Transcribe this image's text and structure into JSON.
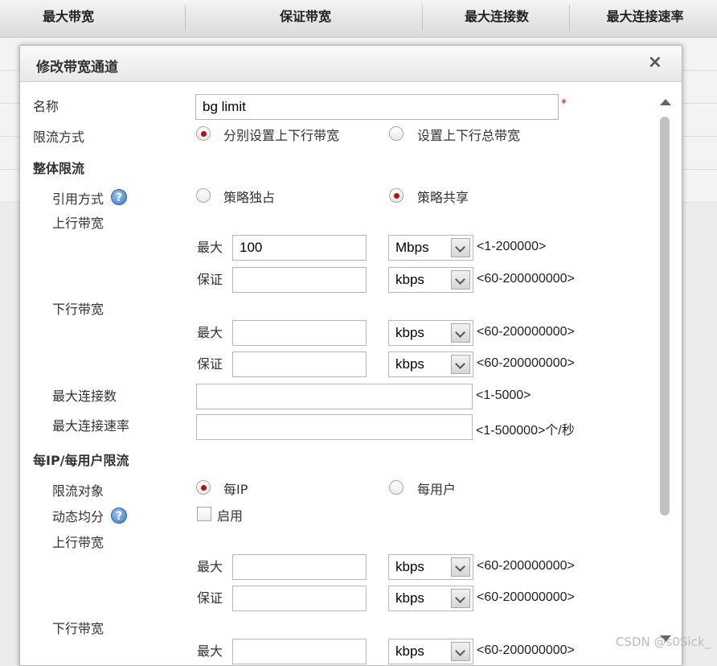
{
  "background_table": {
    "headers": [
      "最大带宽",
      "保证带宽",
      "最大连接数",
      "最大连接速率"
    ]
  },
  "dialog": {
    "title": "修改带宽通道",
    "close_symbol": "×"
  },
  "form": {
    "name_label": "名称",
    "name_value": "bg limit",
    "required_mark": "*",
    "limit_mode_label": "限流方式",
    "limit_mode_options": [
      "分别设置上下行带宽",
      "设置上下行总带宽"
    ],
    "limit_mode_selected": "分别设置上下行带宽",
    "overall_section": "整体限流",
    "ref_mode_label": "引用方式",
    "help_symbol": "?",
    "ref_mode_options": [
      "策略独占",
      "策略共享"
    ],
    "ref_mode_selected": "策略共享",
    "up_bandwidth_label": "上行带宽",
    "down_bandwidth_label": "下行带宽",
    "max_label": "最大",
    "guarantee_label": "保证",
    "overall_up_max_value": "100",
    "overall_up_max_unit": "Mbps",
    "overall_up_max_range": "<1-200000>",
    "overall_up_guar_unit": "kbps",
    "overall_up_guar_range": "<60-200000000>",
    "overall_down_max_unit": "kbps",
    "overall_down_max_range": "<60-200000000>",
    "overall_down_guar_unit": "kbps",
    "overall_down_guar_range": "<60-200000000>",
    "max_conn_label": "最大连接数",
    "max_conn_range": "<1-5000>",
    "max_conn_rate_label": "最大连接速率",
    "max_conn_rate_range": "<1-500000>个/秒",
    "per_ip_section": "每IP/每用户限流",
    "limit_target_label": "限流对象",
    "limit_target_options": [
      "每IP",
      "每用户"
    ],
    "limit_target_selected": "每IP",
    "dynamic_share_label": "动态均分",
    "enable_label": "启用",
    "enable_checked": false,
    "per_up_max_unit": "kbps",
    "per_up_max_range": "<60-200000000>",
    "per_up_guar_unit": "kbps",
    "per_up_guar_range": "<60-200000000>",
    "per_down_max_unit": "kbps",
    "per_down_max_range": "<60-200000000>"
  },
  "watermark": "CSDN @s0Sick_",
  "colors": {
    "radio_selected": "#b01414",
    "required": "#dd0000",
    "help_icon": "#3a78c8"
  }
}
